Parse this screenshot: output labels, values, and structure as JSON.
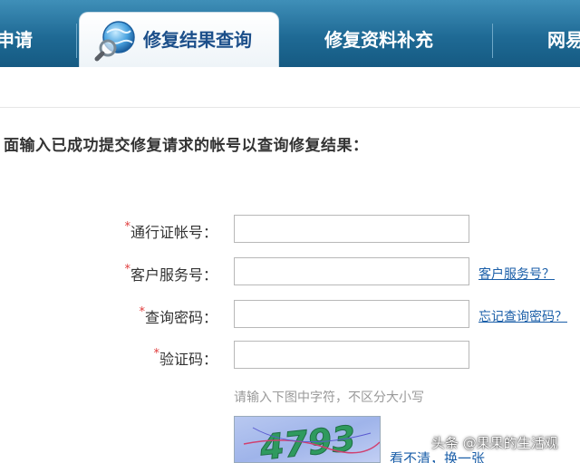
{
  "tabs": {
    "apply_label": "申请",
    "query_label": "修复结果查询",
    "supplement_label": "修复资料补充",
    "next_label": "网易"
  },
  "instruction": "面输入已成功提交修复请求的帐号以查询修复结果：",
  "form": {
    "required_mark": "*",
    "account": {
      "label": "通行证帐号：",
      "value": ""
    },
    "service_no": {
      "label": "客户服务号：",
      "value": "",
      "help_link": "客户服务号？"
    },
    "query_password": {
      "label": "查询密码：",
      "value": "",
      "help_link": "忘记查询密码？"
    },
    "captcha": {
      "label": "验证码：",
      "value": "",
      "hint": "请输入下图中字符，不区分大小写",
      "image_text": "4793",
      "refresh_link": "看不清，换一张"
    }
  },
  "watermark": "头条 @果果的生活观",
  "colors": {
    "tabbar": "#1f6a95",
    "active_tab_text": "#1c4f8a",
    "link": "#1a5ea8",
    "required": "#e03c3c"
  }
}
